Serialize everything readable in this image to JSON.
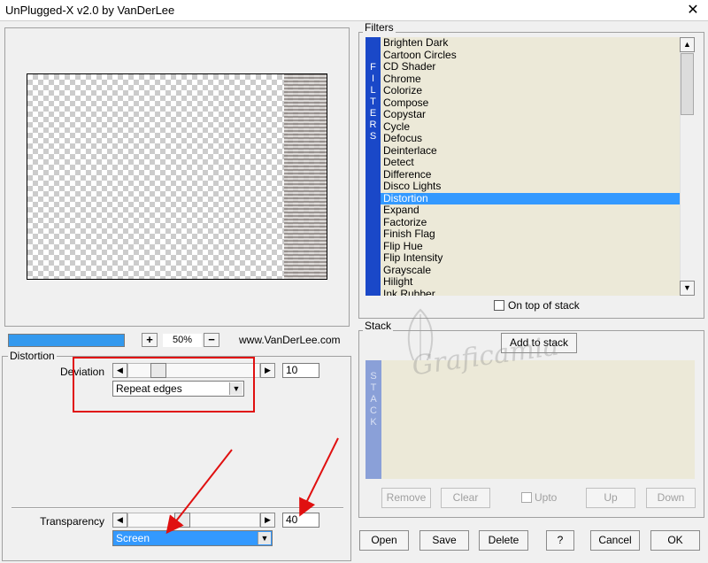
{
  "window": {
    "title": "UnPlugged-X v2.0 by VanDerLee",
    "close_glyph": "✕"
  },
  "preview": {
    "zoom": "50%",
    "zoom_in": "+",
    "zoom_out": "−",
    "website": "www.VanDerLee.com",
    "progress_fraction": 1.0
  },
  "distortion": {
    "group_title": "Distortion",
    "deviation": {
      "label": "Deviation",
      "value": "10",
      "slider_fraction": 0.2
    },
    "edge_mode": {
      "selected": "Repeat edges"
    },
    "transparency": {
      "label": "Transparency",
      "value": "40",
      "slider_fraction": 0.4
    },
    "blend_mode": {
      "selected": "Screen"
    }
  },
  "filters": {
    "group_title": "Filters",
    "sidebar_letters": [
      "F",
      "I",
      "L",
      "T",
      "E",
      "R",
      "S"
    ],
    "selected_index": 13,
    "items": [
      "Brighten Dark",
      "Cartoon Circles",
      "CD Shader",
      "Chrome",
      "Colorize",
      "Compose",
      "Copystar",
      "Cycle",
      "Defocus",
      "Deinterlace",
      "Detect",
      "Difference",
      "Disco Lights",
      "Distortion",
      "Expand",
      "Factorize",
      "Finish Flag",
      "Flip Hue",
      "Flip Intensity",
      "Grayscale",
      "Hilight",
      "Ink Rubber"
    ],
    "on_top_label": "On top of stack",
    "on_top_checked": false
  },
  "stack": {
    "group_title": "Stack",
    "add_label": "Add to stack",
    "sidebar_letters": [
      "S",
      "T",
      "A",
      "C",
      "K"
    ],
    "remove_label": "Remove",
    "clear_label": "Clear",
    "upto_label": "Upto",
    "up_label": "Up",
    "down_label": "Down"
  },
  "footer": {
    "open_label": "Open",
    "save_label": "Save",
    "delete_label": "Delete",
    "help_label": "?",
    "cancel_label": "Cancel",
    "ok_label": "OK"
  },
  "watermark_text": "Graficamia",
  "colors": {
    "accent": "#3399ff",
    "filters_sidebar": "#1a48c8",
    "list_bg": "#ece9d8",
    "annotation": "#e01010"
  }
}
